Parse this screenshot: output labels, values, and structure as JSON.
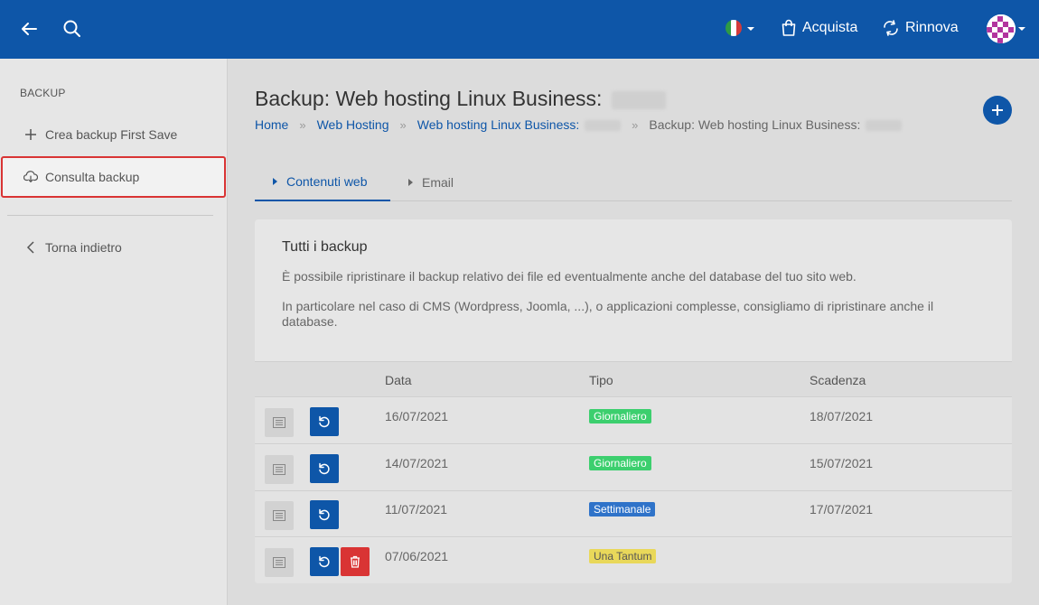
{
  "topbar": {
    "buy_label": "Acquista",
    "renew_label": "Rinnova"
  },
  "sidebar": {
    "heading": "BACKUP",
    "items": [
      {
        "label": "Crea backup First Save",
        "icon": "plus-icon"
      },
      {
        "label": "Consulta backup",
        "icon": "cloud-download-icon"
      },
      {
        "label": "Torna indietro",
        "icon": "chevron-left-icon"
      }
    ]
  },
  "page": {
    "title": "Backup: Web hosting Linux Business:",
    "breadcrumb": [
      "Home",
      "Web Hosting",
      "Web hosting Linux Business:",
      "Backup: Web hosting Linux Business:"
    ],
    "breadcrumb_separator": "»"
  },
  "tabs": [
    {
      "label": "Contenuti web",
      "active": true
    },
    {
      "label": "Email",
      "active": false
    }
  ],
  "card": {
    "title": "Tutti i backup",
    "paragraph1": "È possibile ripristinare il backup relativo dei file ed eventualmente anche del database del tuo sito web.",
    "paragraph2": "In particolare nel caso di CMS (Wordpress, Joomla, ...), o applicazioni complesse, consigliamo di ripristinare anche il database."
  },
  "table": {
    "columns": [
      "Data",
      "Tipo",
      "Scadenza"
    ],
    "rows": [
      {
        "date": "16/07/2021",
        "type": "Giornaliero",
        "type_color": "#3ccf6e",
        "expiry": "18/07/2021",
        "deletable": false
      },
      {
        "date": "14/07/2021",
        "type": "Giornaliero",
        "type_color": "#3ccf6e",
        "expiry": "15/07/2021",
        "deletable": false
      },
      {
        "date": "11/07/2021",
        "type": "Settimanale",
        "type_color": "#2f73c9",
        "expiry": "17/07/2021",
        "deletable": false
      },
      {
        "date": "07/06/2021",
        "type": "Una Tantum",
        "type_color": "#e9d85a",
        "expiry": "",
        "deletable": true
      }
    ]
  },
  "colors": {
    "brand": "#0e56a8",
    "danger": "#d93434"
  }
}
